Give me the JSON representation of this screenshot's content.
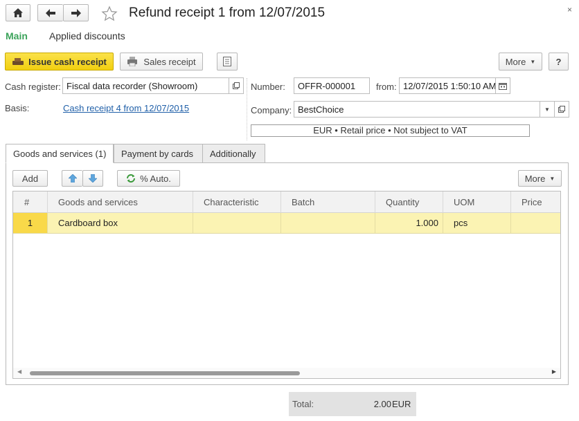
{
  "window": {
    "title": "Refund receipt 1 from 12/07/2015",
    "close_symbol": "×"
  },
  "nav_tabs": [
    {
      "label": "Main"
    },
    {
      "label": "Applied discounts"
    }
  ],
  "toolbar": {
    "issue_label": "Issue cash receipt",
    "sales_receipt_label": "Sales receipt",
    "more_label": "More",
    "help_label": "?"
  },
  "header": {
    "cash_register_label": "Cash register:",
    "cash_register_value": "Fiscal data recorder (Showroom)",
    "basis_label": "Basis:",
    "basis_link": "Cash receipt 4 from 12/07/2015",
    "number_label": "Number:",
    "number_value": "OFFR-000001",
    "from_label": "from:",
    "date_value": "12/07/2015  1:50:10 AM",
    "company_label": "Company:",
    "company_value": "BestChoice",
    "price_info": "EUR • Retail price • Not subject to VAT"
  },
  "tabs": [
    {
      "label": "Goods and services (1)"
    },
    {
      "label": "Payment by cards"
    },
    {
      "label": "Additionally"
    }
  ],
  "table_toolbar": {
    "add_label": "Add",
    "auto_label": "% Auto.",
    "more_label": "More"
  },
  "table": {
    "columns": [
      "#",
      "Goods and services",
      "Characteristic",
      "Batch",
      "Quantity",
      "UOM",
      "Price"
    ],
    "rows": [
      {
        "num": "1",
        "goods": "Cardboard box",
        "characteristic": "",
        "batch": "",
        "quantity": "1.000",
        "uom": "pcs",
        "price": ""
      }
    ]
  },
  "footer": {
    "total_label": "Total:",
    "total_value": "2.00",
    "currency": "EUR"
  },
  "colors": {
    "accent_yellow": "#f7d81f",
    "active_tab_green": "#3ba35a",
    "selected_row": "#fbf3b3",
    "link_blue": "#1f5fa8"
  }
}
